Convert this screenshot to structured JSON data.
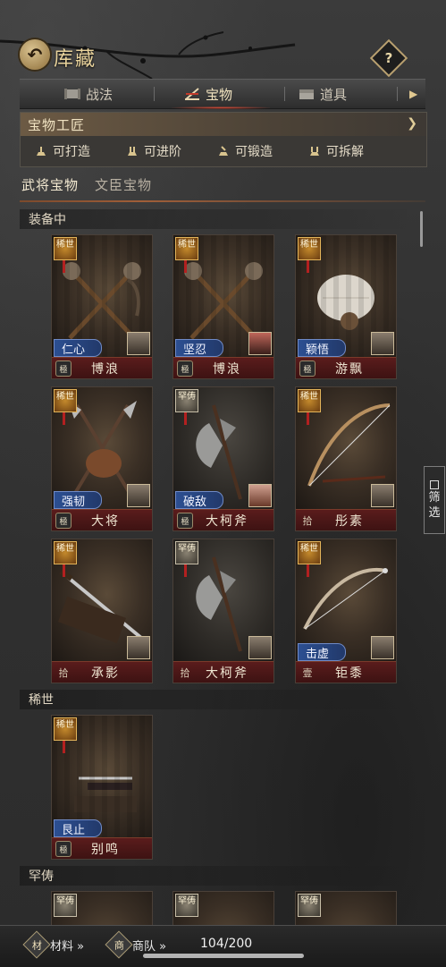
{
  "header": {
    "title": "库藏",
    "help": "?"
  },
  "tabs": [
    {
      "label": "战法",
      "icon": "scroll-icon"
    },
    {
      "label": "宝物",
      "icon": "weapon-rack-icon",
      "active": true
    },
    {
      "label": "道具",
      "icon": "chest-icon"
    }
  ],
  "craftsman": {
    "title": "宝物工匠",
    "actions": [
      "可打造",
      "可进阶",
      "可锻造",
      "可拆解"
    ]
  },
  "subtabs": [
    "武将宝物",
    "文臣宝物"
  ],
  "sections": {
    "equipped": "装备中",
    "rare": "稀世",
    "scarce": "罕俦"
  },
  "cards": [
    {
      "rarity": "稀世",
      "level": "極",
      "name": "博浪",
      "hero": "仁心"
    },
    {
      "rarity": "稀世",
      "level": "極",
      "name": "博浪",
      "hero": "坚忍"
    },
    {
      "rarity": "稀世",
      "level": "極",
      "name": "游飘",
      "hero": "颖悟"
    },
    {
      "rarity": "稀世",
      "level": "極",
      "name": "大将",
      "hero": "强韧"
    },
    {
      "rarity": "罕俦",
      "level": "極",
      "name": "大柯斧",
      "hero": "破敌"
    },
    {
      "rarity": "稀世",
      "level": "拾",
      "name": "彤素",
      "hero": ""
    },
    {
      "rarity": "稀世",
      "level": "拾",
      "name": "承影",
      "hero": ""
    },
    {
      "rarity": "罕俦",
      "level": "拾",
      "name": "大柯斧",
      "hero": ""
    },
    {
      "rarity": "稀世",
      "level": "壹",
      "name": "钜黍",
      "hero": "击虚"
    },
    {
      "rarity": "稀世",
      "level": "極",
      "name": "别鸣",
      "hero": "艮止"
    }
  ],
  "filter": {
    "label_1": "筛",
    "label_2": "选"
  },
  "bottom": {
    "materials": "材料 »",
    "materials_icon": "材",
    "caravan": "商队 »",
    "caravan_icon": "商",
    "capacity": "104/200"
  }
}
